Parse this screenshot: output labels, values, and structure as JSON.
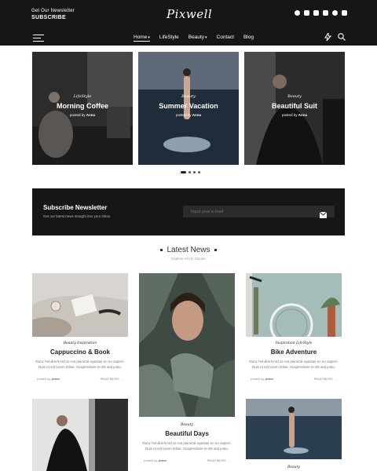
{
  "header": {
    "newsletter_small": "Get Our Newsletter",
    "newsletter_big": "SUBSCRIBE",
    "logo": "Pixwell",
    "social_icons": [
      "pinterest-icon",
      "instagram-icon",
      "linkedin-icon",
      "youtube-icon",
      "whatsapp-icon",
      "vk-icon"
    ],
    "nav": [
      "Home",
      "LifeStyle",
      "Beauty",
      "Contact",
      "Blog"
    ]
  },
  "slider": [
    {
      "category": "LifeStyle",
      "title": "Morning Coffee",
      "posted_by": "posted by",
      "author": "Anna"
    },
    {
      "category": "Beauty",
      "title": "Summer Vacation",
      "posted_by": "posted by",
      "author": "Anna"
    },
    {
      "category": "Beauty",
      "title": "Beautiful Suit",
      "posted_by": "posted by",
      "author": "Anna"
    }
  ],
  "subscribe": {
    "title": "Subscribe Newsletter",
    "text": "Get our latest news straight into your inbox",
    "placeholder": "Input your e-mail"
  },
  "latest": {
    "title": "Latest News",
    "subtitle": "Explore All Us Stories"
  },
  "posts": [
    {
      "categories": "Beauty  Inspiration",
      "title": "Cappuccino & Book",
      "excerpt": "Nunc hendrerit nisl ac est placerat egestas eu eu sapien. Duis et est lorem tellus. Suspendisse et elit sed justo.",
      "posted_by": "posted by",
      "author": "Anna",
      "read_more": "READ MORE →"
    },
    {
      "categories": "Beauty",
      "title": "Beautiful Days",
      "excerpt": "Nunc hendrerit nisl ac est placerat egestas eu eu sapien. Duis et est lorem tellus. Suspendisse et elit sed justo.",
      "posted_by": "posted by",
      "author": "Anna",
      "read_more": "READ MORE →"
    },
    {
      "categories": "Inspiration  LifeStyle",
      "title": "Bike Adventure",
      "excerpt": "Nunc hendrerit nisl ac est placerat egestas eu eu sapien. Duis et est lorem tellus. Suspendisse et elit sed justo.",
      "posted_by": "posted by",
      "author": "Anna",
      "read_more": "READ MORE →"
    },
    {
      "categories": "Beauty"
    }
  ]
}
